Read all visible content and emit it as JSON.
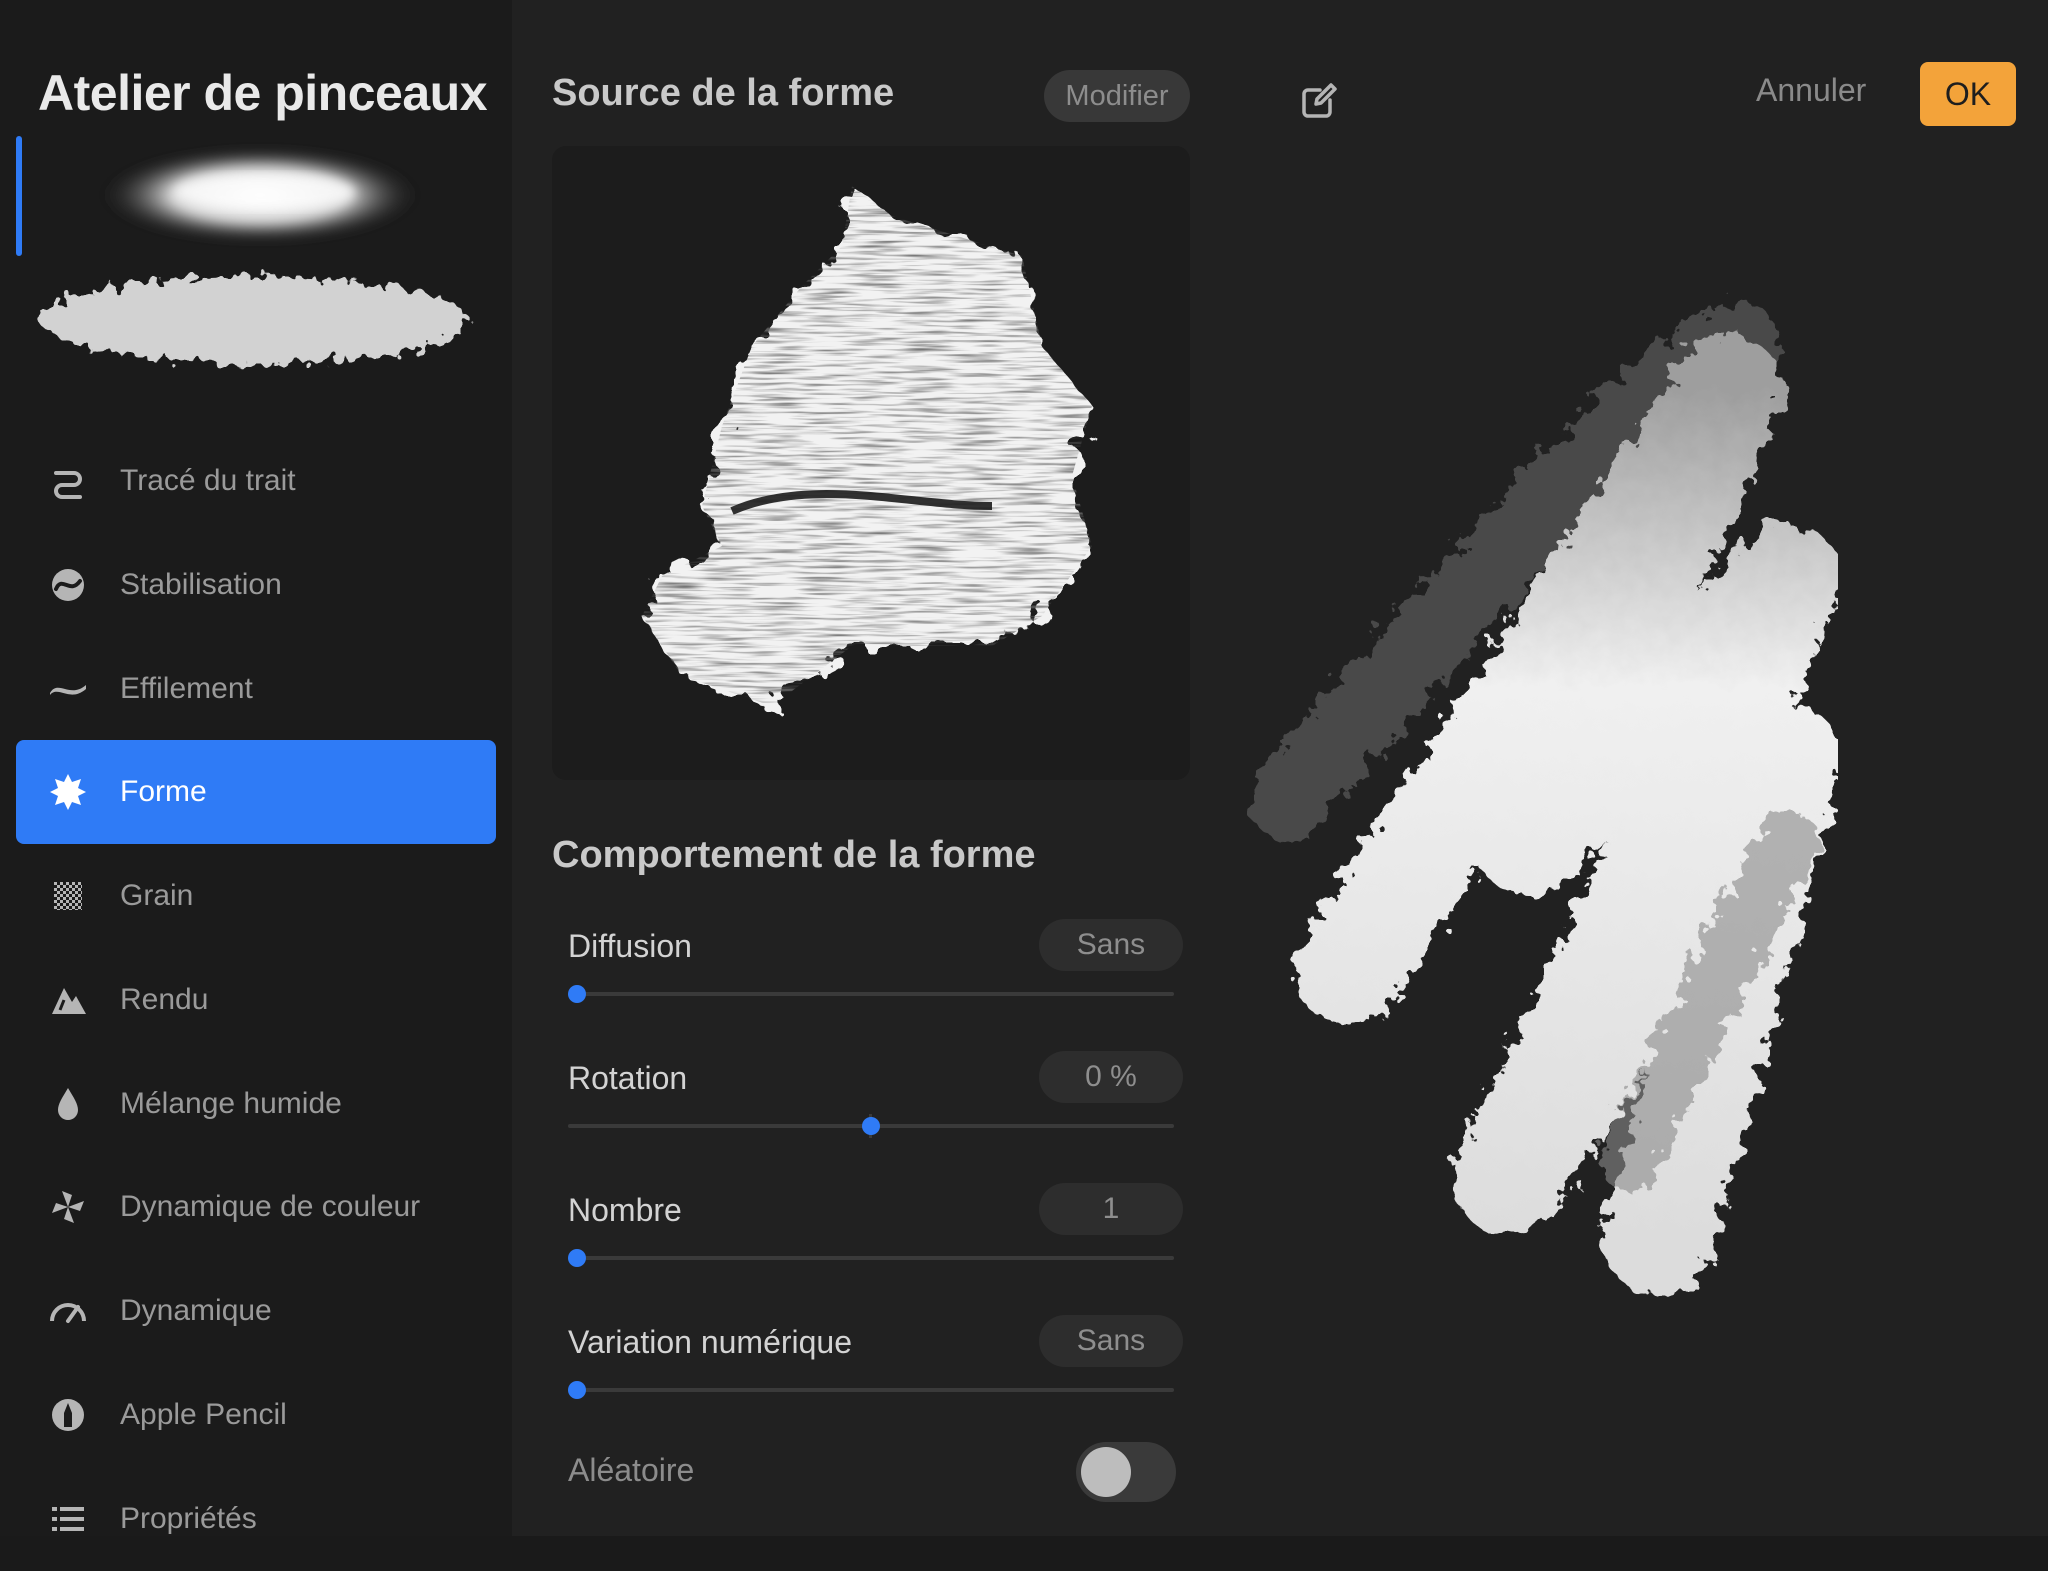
{
  "sidebar": {
    "title": "Atelier de pinceaux",
    "items": [
      {
        "label": "Tracé du trait",
        "icon": "stroke-path-icon"
      },
      {
        "label": "Stabilisation",
        "icon": "stabilization-icon"
      },
      {
        "label": "Effilement",
        "icon": "taper-icon"
      },
      {
        "label": "Forme",
        "icon": "shape-icon",
        "active": true
      },
      {
        "label": "Grain",
        "icon": "grain-icon"
      },
      {
        "label": "Rendu",
        "icon": "rendering-icon"
      },
      {
        "label": "Mélange humide",
        "icon": "wet-mix-icon"
      },
      {
        "label": "Dynamique de couleur",
        "icon": "color-dynamics-icon"
      },
      {
        "label": "Dynamique",
        "icon": "dynamics-icon"
      },
      {
        "label": "Apple Pencil",
        "icon": "apple-pencil-icon"
      },
      {
        "label": "Propriétés",
        "icon": "properties-icon"
      }
    ]
  },
  "source": {
    "title": "Source de la forme",
    "edit_label": "Modifier"
  },
  "behavior": {
    "title": "Comportement de la forme",
    "sliders": [
      {
        "label": "Diffusion",
        "value": "Sans",
        "fraction": 0.0
      },
      {
        "label": "Rotation",
        "value": "0 %",
        "fraction": 0.5
      },
      {
        "label": "Nombre",
        "value": "1",
        "fraction": 0.0
      },
      {
        "label": "Variation numérique",
        "value": "Sans",
        "fraction": 0.0
      }
    ],
    "random_label": "Aléatoire",
    "random_on": false
  },
  "preview": {
    "cancel_label": "Annuler",
    "ok_label": "OK"
  },
  "colors": {
    "accent": "#2f7bf6",
    "ok_button": "#f3a33a"
  }
}
